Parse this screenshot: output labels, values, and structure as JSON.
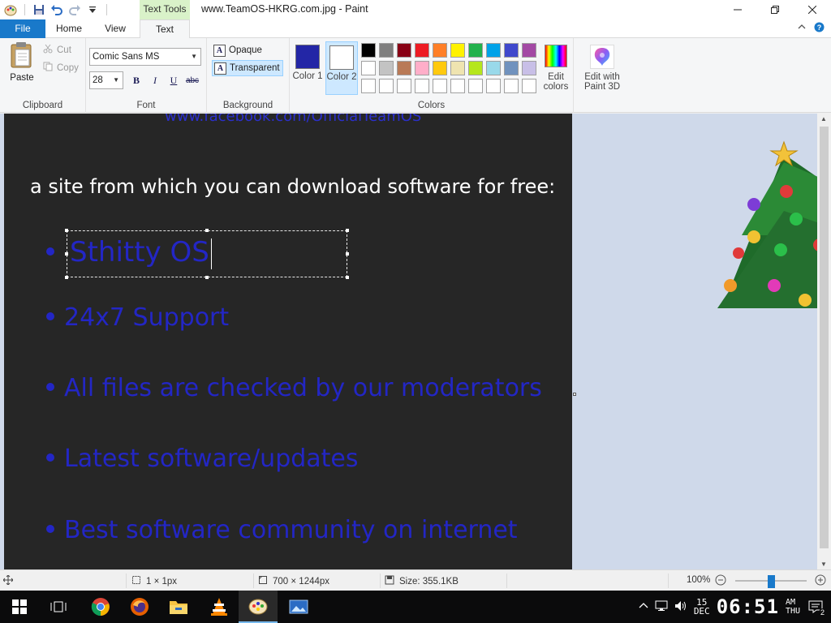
{
  "window": {
    "title": "www.TeamOS-HKRG.com.jpg - Paint",
    "context_tab_group": "Text Tools"
  },
  "tabs": {
    "file": "File",
    "home": "Home",
    "view": "View",
    "text": "Text"
  },
  "clipboard": {
    "paste": "Paste",
    "cut": "Cut",
    "copy": "Copy",
    "group_label": "Clipboard"
  },
  "font": {
    "family": "Comic Sans MS",
    "size": "28",
    "bold": "B",
    "italic": "I",
    "underline": "U",
    "strike": "abc",
    "group_label": "Font"
  },
  "background": {
    "opaque": "Opaque",
    "transparent": "Transparent",
    "selected": "Transparent",
    "group_label": "Background"
  },
  "colors": {
    "color1_label": "Color 1",
    "color2_label": "Color 2",
    "color1": "#2326a6",
    "color2": "#ffffff",
    "edit_colors": "Edit colors",
    "group_label": "Colors",
    "palette": [
      "#000000",
      "#7f7f7f",
      "#880015",
      "#ed1c24",
      "#ff7f27",
      "#fff200",
      "#22b14c",
      "#00a2e8",
      "#3f48cc",
      "#a349a4",
      "#ffffff",
      "#c3c3c3",
      "#b97a57",
      "#ffaec9",
      "#ffc90e",
      "#efe4b0",
      "#b5e61d",
      "#99d9ea",
      "#7092be",
      "#c8bfe7",
      "#ffffff",
      "#ffffff",
      "#ffffff",
      "#ffffff",
      "#ffffff",
      "#ffffff",
      "#ffffff",
      "#ffffff",
      "#ffffff",
      "#ffffff"
    ]
  },
  "paint3d": {
    "label": "Edit with Paint 3D"
  },
  "canvas": {
    "url_text": "www.facebook.com/OfficialTeamOS",
    "heading": "a site from which you can download software for free:",
    "editing_text": "Sthitty OS",
    "bullets": [
      "24x7 Support",
      "All files are checked by our moderators",
      "Latest software/updates",
      "Best software community on internet"
    ]
  },
  "status": {
    "selection_size": "1 × 1px",
    "image_size": "700 × 1244px",
    "file_size": "Size: 355.1KB",
    "zoom": "100%"
  },
  "taskbar": {
    "time": "06:51",
    "ampm": "AM",
    "day": "THU",
    "date_day": "15",
    "date_month": "DEC",
    "notifications": "2"
  }
}
